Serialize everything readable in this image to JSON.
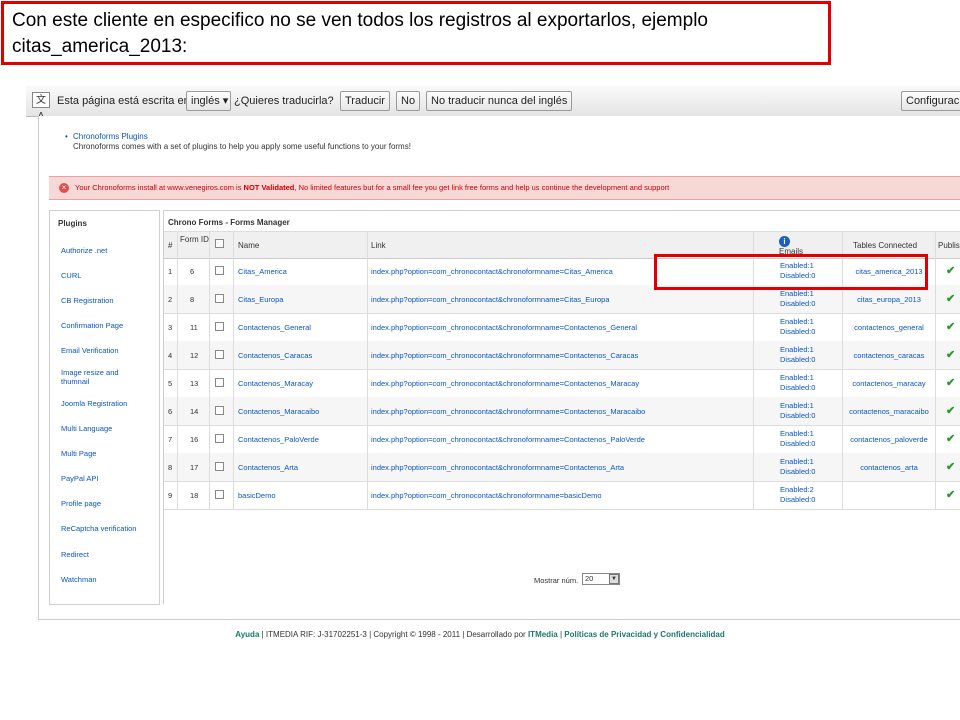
{
  "callout": {
    "line1": "Con este cliente en especifico no se ven todos los registros al exportarlos, ejemplo",
    "line2": "citas_america_2013:"
  },
  "translate_bar": {
    "icon": "translate-icon",
    "prefix": "Esta página está escrita en",
    "language": "inglés ▾",
    "question": "¿Quieres traducirla?",
    "translate_btn": "Traducir",
    "no_btn": "No",
    "never_btn": "No traducir nunca del inglés",
    "config_btn": "Configuraci"
  },
  "plugins_note": {
    "title": "Chronoforms Plugins",
    "desc": "Chronoforms comes with a set of plugins to help you apply some useful functions to your forms!"
  },
  "warning": {
    "pre": "Your Chronoforms install at www.venegiros.com is ",
    "bold": "NOT Validated",
    "post": ", No limited features but for a small fee you get link free forms and help us continue the development and support"
  },
  "sidebar": {
    "title": "Plugins",
    "items": [
      "Authorize .net",
      "CURL",
      "CB Registration",
      "Confirmation Page",
      "Email Verification",
      "Image resize and thumnail",
      "Joomla Registration",
      "Multi Language",
      "Multi Page",
      "PayPal API",
      "Profile page",
      "ReCaptcha verification",
      "Redirect",
      "Watchman"
    ]
  },
  "forms_manager": {
    "title": "Chrono Forms - Forms Manager",
    "headers": {
      "num": "#",
      "form_id": "Form ID",
      "name": "Name",
      "link": "Link",
      "emails": "Emails",
      "tables": "Tables Connected",
      "publish": "Publis"
    },
    "rows": [
      {
        "num": "1",
        "id": "6",
        "name": "Citas_America",
        "link": "index.php?option=com_chronocontact&chronoformname=Citas_America",
        "enabled": "Enabled:1",
        "disabled": "Disabled:0",
        "table": "citas_america_2013"
      },
      {
        "num": "2",
        "id": "8",
        "name": "Citas_Europa",
        "link": "index.php?option=com_chronocontact&chronoformname=Citas_Europa",
        "enabled": "Enabled:1",
        "disabled": "Disabled:0",
        "table": "citas_europa_2013"
      },
      {
        "num": "3",
        "id": "11",
        "name": "Contactenos_General",
        "link": "index.php?option=com_chronocontact&chronoformname=Contactenos_General",
        "enabled": "Enabled:1",
        "disabled": "Disabled:0",
        "table": "contactenos_general"
      },
      {
        "num": "4",
        "id": "12",
        "name": "Contactenos_Caracas",
        "link": "index.php?option=com_chronocontact&chronoformname=Contactenos_Caracas",
        "enabled": "Enabled:1",
        "disabled": "Disabled:0",
        "table": "contactenos_caracas"
      },
      {
        "num": "5",
        "id": "13",
        "name": "Contactenos_Maracay",
        "link": "index.php?option=com_chronocontact&chronoformname=Contactenos_Maracay",
        "enabled": "Enabled:1",
        "disabled": "Disabled:0",
        "table": "contactenos_maracay"
      },
      {
        "num": "6",
        "id": "14",
        "name": "Contactenos_Maracaibo",
        "link": "index.php?option=com_chronocontact&chronoformname=Contactenos_Maracaibo",
        "enabled": "Enabled:1",
        "disabled": "Disabled:0",
        "table": "contactenos_maracaibo"
      },
      {
        "num": "7",
        "id": "16",
        "name": "Contactenos_PaloVerde",
        "link": "index.php?option=com_chronocontact&chronoformname=Contactenos_PaloVerde",
        "enabled": "Enabled:1",
        "disabled": "Disabled:0",
        "table": "contactenos_paloverde"
      },
      {
        "num": "8",
        "id": "17",
        "name": "Contactenos_Arta",
        "link": "index.php?option=com_chronocontact&chronoformname=Contactenos_Arta",
        "enabled": "Enabled:1",
        "disabled": "Disabled:0",
        "table": "contactenos_arta"
      },
      {
        "num": "9",
        "id": "18",
        "name": "basicDemo",
        "link": "index.php?option=com_chronocontact&chronoformname=basicDemo",
        "enabled": "Enabled:2",
        "disabled": "Disabled:0",
        "table": ""
      }
    ],
    "pager_label": "Mostrar núm.",
    "pager_value": "20"
  },
  "footer": {
    "help": "Ayuda",
    "sep1": " | ITMEDIA RIF: J-31702251-3 | Copyright © 1998 - 2011 | Desarrollado por ",
    "brand": "ITMedia",
    "sep2": " | ",
    "privacy": "Políticas de Privacidad y Confidencialidad"
  },
  "colors": {
    "highlight": "#e00000",
    "link": "#0b55c4",
    "warning_bg": "#f8d7d7",
    "check": "#2a9a2a",
    "footer_link": "#1a7a6a"
  }
}
